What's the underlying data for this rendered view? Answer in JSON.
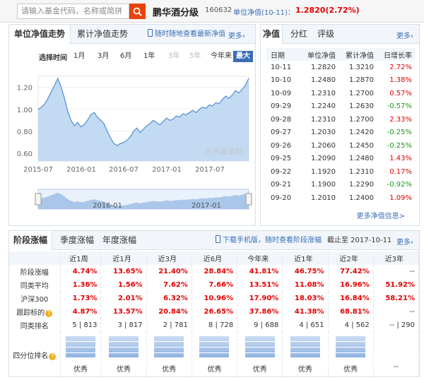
{
  "search": {
    "placeholder": "请输入基金代码、名称或简拼"
  },
  "fund": {
    "name": "鹏华酒分级",
    "code": "160632",
    "nav_label": "单位净值(10-11)：",
    "nav_value": "1.2820(2.72%)"
  },
  "chart_panel": {
    "tabs": [
      "单位净值走势",
      "累计净值走势"
    ],
    "promo": "随时随地查看最新净值",
    "more": "更多",
    "range_label": "选择时间",
    "ranges": [
      {
        "label": "1月",
        "state": "normal"
      },
      {
        "label": "3月",
        "state": "normal"
      },
      {
        "label": "6月",
        "state": "normal"
      },
      {
        "label": "1年",
        "state": "normal"
      },
      {
        "label": "3年",
        "state": "disabled"
      },
      {
        "label": "5年",
        "state": "disabled"
      },
      {
        "label": "今年来",
        "state": "normal"
      },
      {
        "label": "最大",
        "state": "selected"
      }
    ],
    "watermark": "天天基金网"
  },
  "chart_data": {
    "type": "area",
    "y_ticks": [
      "1.20",
      "1.00",
      "0.80",
      "0.60"
    ],
    "x_ticks": [
      "2015-07",
      "2016-01",
      "2016-07",
      "2017-01",
      "2017-07"
    ],
    "mini_x_ticks": [
      "2016-01",
      "2017-01"
    ],
    "ylim": [
      0.53,
      1.3
    ],
    "grid": true,
    "series": [
      {
        "values": [
          1.0,
          1.02,
          1.05,
          1.1,
          1.16,
          1.22,
          1.28,
          1.2,
          1.1,
          0.98,
          0.9,
          0.85,
          0.88,
          0.84,
          0.86,
          0.9,
          0.95,
          0.97,
          0.93,
          0.9,
          0.87,
          0.8,
          0.74,
          0.69,
          0.67,
          0.69,
          0.7,
          0.72,
          0.75,
          0.8,
          0.83,
          0.79,
          0.82,
          0.85,
          0.87,
          0.9,
          0.88,
          0.86,
          0.89,
          0.92,
          0.9,
          0.91,
          0.94,
          0.93,
          0.96,
          0.95,
          0.97,
          0.99,
          0.97,
          1.0,
          1.02,
          1.01,
          1.04,
          1.03,
          1.06,
          1.05,
          1.09,
          1.12,
          1.1,
          1.13,
          1.17,
          1.15,
          1.18,
          1.22,
          1.28
        ]
      }
    ]
  },
  "nav_panel": {
    "tabs": [
      "净值",
      "分红",
      "评级"
    ],
    "more": "更多",
    "headers": [
      "日期",
      "单位净值",
      "累计净值",
      "日增长率"
    ],
    "rows": [
      {
        "date": "10-11",
        "nav": "1.2820",
        "acc": "1.3210",
        "chg": "2.72%",
        "dir": "up"
      },
      {
        "date": "10-10",
        "nav": "1.2480",
        "acc": "1.2870",
        "chg": "1.38%",
        "dir": "up"
      },
      {
        "date": "10-09",
        "nav": "1.2310",
        "acc": "1.2700",
        "chg": "0.57%",
        "dir": "up"
      },
      {
        "date": "09-29",
        "nav": "1.2240",
        "acc": "1.2630",
        "chg": "-0.57%",
        "dir": "down"
      },
      {
        "date": "09-28",
        "nav": "1.2310",
        "acc": "1.2700",
        "chg": "2.33%",
        "dir": "up"
      },
      {
        "date": "09-27",
        "nav": "1.2030",
        "acc": "1.2420",
        "chg": "-0.25%",
        "dir": "down"
      },
      {
        "date": "09-26",
        "nav": "1.2060",
        "acc": "1.2450",
        "chg": "-0.25%",
        "dir": "down"
      },
      {
        "date": "09-25",
        "nav": "1.2090",
        "acc": "1.2480",
        "chg": "1.43%",
        "dir": "up"
      },
      {
        "date": "09-22",
        "nav": "1.1920",
        "acc": "1.2310",
        "chg": "0.17%",
        "dir": "up"
      },
      {
        "date": "09-21",
        "nav": "1.1900",
        "acc": "1.2290",
        "chg": "-0.92%",
        "dir": "down"
      },
      {
        "date": "09-20",
        "nav": "1.2010",
        "acc": "1.2400",
        "chg": "1.09%",
        "dir": "up"
      }
    ],
    "more_link": "更多净值信息>"
  },
  "perf_panel": {
    "tabs": [
      "阶段涨幅",
      "季度涨幅",
      "年度涨幅"
    ],
    "promo": "下载手机版，随时查看阶段涨幅",
    "cutoff": "截止至 2017-10-11",
    "more": "更多",
    "columns": [
      "近1周",
      "近1月",
      "近3月",
      "近6月",
      "今年来",
      "近1年",
      "近2年",
      "近3年"
    ],
    "rows": [
      {
        "label": "阶段涨幅",
        "values": [
          "4.74%",
          "13.65%",
          "21.40%",
          "28.84%",
          "41.81%",
          "46.75%",
          "77.42%",
          "--"
        ],
        "style": "red"
      },
      {
        "label": "同类平均",
        "values": [
          "1.36%",
          "1.56%",
          "7.62%",
          "7.66%",
          "13.51%",
          "11.08%",
          "16.96%",
          "51.92%"
        ],
        "style": "red"
      },
      {
        "label": "沪深300",
        "values": [
          "1.73%",
          "2.01%",
          "6.32%",
          "10.96%",
          "17.90%",
          "18.03%",
          "16.84%",
          "58.21%"
        ],
        "style": "red"
      },
      {
        "label": "跟踪标的",
        "values": [
          "4.87%",
          "13.57%",
          "20.84%",
          "26.65%",
          "37.86%",
          "41.38%",
          "68.81%",
          "--"
        ],
        "style": "red"
      },
      {
        "label": "同类排名",
        "values": [
          "5 | 813",
          "3 | 817",
          "2 | 781",
          "8 | 728",
          "9 | 688",
          "4 | 651",
          "4 | 562",
          "-- | 290"
        ],
        "style": "plain"
      }
    ],
    "quartile_label": "四分位排名",
    "quartile": [
      "优秀",
      "优秀",
      "优秀",
      "优秀",
      "优秀",
      "优秀",
      "优秀",
      "--"
    ]
  }
}
